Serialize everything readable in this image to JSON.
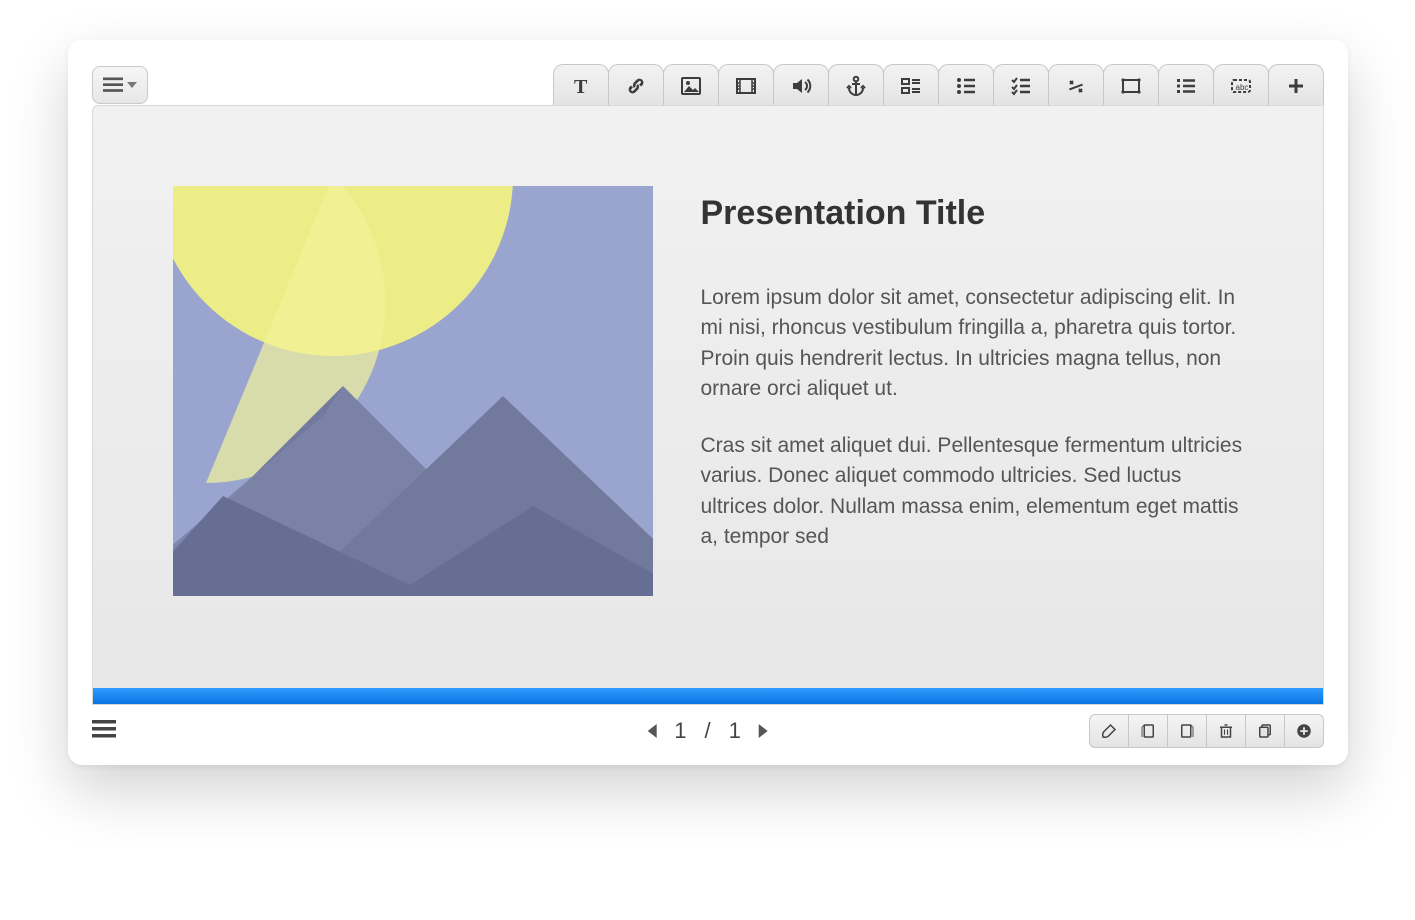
{
  "toolbar": {
    "menu_button": "menu",
    "tools": [
      "text",
      "link",
      "image",
      "video",
      "audio",
      "anchor",
      "layout",
      "bullets",
      "checklist",
      "fraction",
      "crop",
      "list",
      "caption",
      "add"
    ]
  },
  "slide": {
    "title": "Presentation Title",
    "paragraph1": "Lorem ipsum dolor sit amet, consectetur adipiscing elit. In mi nisi, rhoncus vestibulum fringilla a, pharetra quis tortor. Proin quis hendrerit lectus. In ultricies magna tellus, non ornare orci aliquet ut.",
    "paragraph2": "Cras sit amet aliquet dui. Pellentesque fermentum ultricies varius. Donec aliquet commodo ultricies. Sed luctus ultrices dolor. Nullam massa enim, elementum eget mattis a, tempor sed",
    "image_alt": "mountain-sun-placeholder"
  },
  "nav": {
    "current_page": "1",
    "separator": "/",
    "total_pages": "1"
  },
  "bottom_tools": [
    "brush",
    "page-back-copy",
    "page-forward-copy",
    "trash",
    "duplicate",
    "add-slide"
  ],
  "colors": {
    "accent_blue": "#1a86ee",
    "placeholder_sky": "#9aa5cf",
    "placeholder_sun": "#eded87",
    "placeholder_mountain": "#717a9c"
  }
}
